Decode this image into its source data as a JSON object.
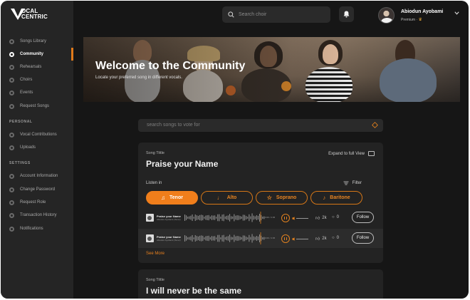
{
  "brand": {
    "line1": "OCAL",
    "line2": "CENTRIC"
  },
  "sidebar": {
    "items": [
      {
        "label": "Songs Library",
        "icon": "library-icon"
      },
      {
        "label": "Community",
        "icon": "community-icon",
        "active": true
      },
      {
        "label": "Rehearsals",
        "icon": "rehearsal-icon"
      },
      {
        "label": "Choirs",
        "icon": "choir-icon"
      },
      {
        "label": "Events",
        "icon": "calendar-icon"
      },
      {
        "label": "Request Songs",
        "icon": "request-icon"
      }
    ],
    "personal_label": "PERSONAL",
    "personal": [
      {
        "label": "Vocal Contributions",
        "icon": "mic-icon"
      },
      {
        "label": "Uploads",
        "icon": "upload-icon"
      }
    ],
    "settings_label": "SETTINGS",
    "settings": [
      {
        "label": "Account Information",
        "icon": "user-icon"
      },
      {
        "label": "Change Password",
        "icon": "lock-icon"
      },
      {
        "label": "Request Role",
        "icon": "role-icon"
      },
      {
        "label": "Transaction History",
        "icon": "history-icon"
      },
      {
        "label": "Notifications",
        "icon": "bell-icon"
      }
    ]
  },
  "topbar": {
    "search_placeholder": "Search choir",
    "user_name": "Abiodun Ayobami",
    "user_plan": "Premium"
  },
  "hero": {
    "title": "Welcome to the Community",
    "subtitle": "Locate your preferred song in different vocals."
  },
  "vote_search": {
    "placeholder": "search songs to vote for"
  },
  "songs": [
    {
      "label": "Song Tittle",
      "title": "Praise your Name",
      "expand_label": "Expand to full View",
      "listen_label": "Listen in",
      "filter_label": "Filter",
      "voices": [
        "Tenor",
        "Alto",
        "Soprano",
        "Baritone"
      ],
      "active_voice": "Tenor",
      "tracks": [
        {
          "name": "Praise your Name",
          "artist": "Abiodun Ayobami (Tenor)",
          "time": "0:00 / 2:45",
          "likes": "2k",
          "comments": "0",
          "follow": "Follow"
        },
        {
          "name": "Praise your Name",
          "artist": "Abiodun Ayobami (Tenor)",
          "time": "0:00 / 2:45",
          "likes": "2k",
          "comments": "0",
          "follow": "Follow"
        }
      ],
      "see_more": "See More"
    },
    {
      "label": "Song Tittle",
      "title": "I will never be the same"
    }
  ],
  "colors": {
    "accent": "#f07e1b",
    "background": "#161616",
    "sidebar": "#252525",
    "card": "#232323"
  }
}
